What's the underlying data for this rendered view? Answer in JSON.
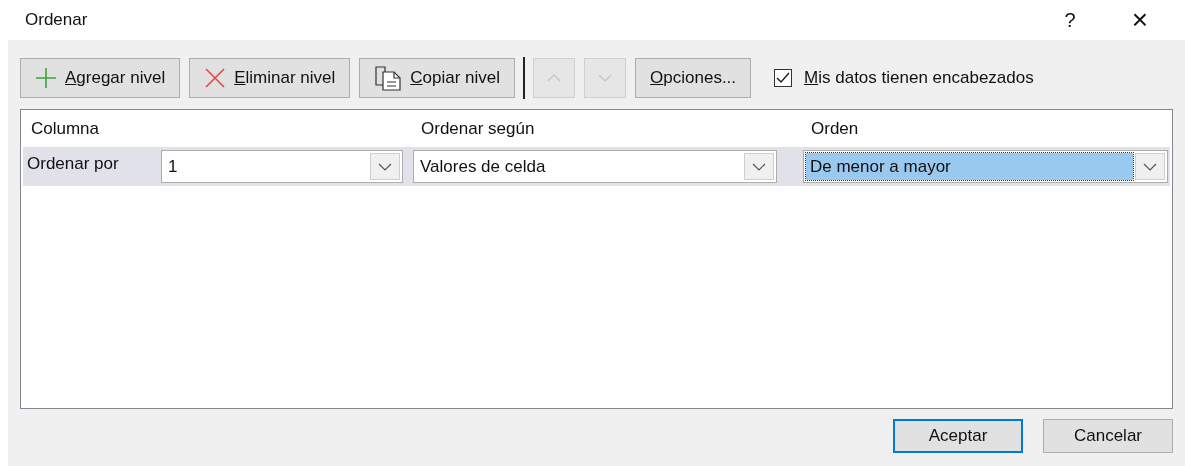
{
  "window": {
    "title": "Ordenar",
    "help": "?",
    "close": "×"
  },
  "toolbar": [
    {
      "kind": "add",
      "label": "Agregar nivel",
      "underline_first": true
    },
    {
      "kind": "delete",
      "label": "Eliminar nivel",
      "underline_first": true
    },
    {
      "kind": "copy",
      "label": "Copiar nivel",
      "underline_first": true
    },
    {
      "kind": "separator"
    },
    {
      "kind": "move_up",
      "disabled": true
    },
    {
      "kind": "move_down",
      "disabled": true
    },
    {
      "kind": "options",
      "label": "Opciones...",
      "underline_first": true
    }
  ],
  "headers_checkbox": {
    "label": "Mis datos tienen encabezados",
    "checked": true,
    "underline_first": true
  },
  "table": {
    "columns": [
      "Columna",
      "Ordenar según",
      "Orden"
    ],
    "rows": [
      {
        "label": "Ordenar por",
        "column": "1",
        "sort_on": "Valores de celda",
        "order": "De menor a mayor",
        "order_focused": true
      }
    ]
  },
  "buttons": [
    {
      "label": "Aceptar",
      "default": true
    },
    {
      "label": "Cancelar",
      "default": false
    }
  ]
}
